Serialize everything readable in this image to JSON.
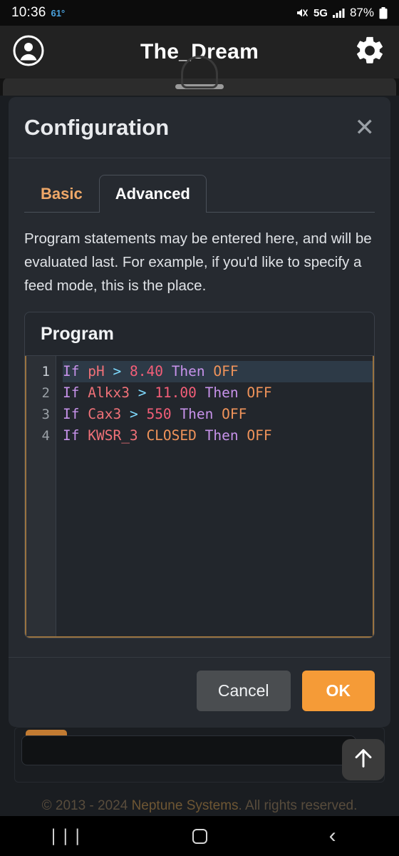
{
  "statusbar": {
    "time": "10:36",
    "temperature": "61°",
    "network": "5G",
    "battery_percent": "87%",
    "icons": {
      "mute": "mute-icon",
      "signal": "signal-bars-icon",
      "battery": "battery-icon"
    }
  },
  "header": {
    "title": "The_Dream",
    "account_icon": "account-circle-icon",
    "settings_icon": "gear-icon"
  },
  "modal": {
    "title": "Configuration",
    "close_label": "✕",
    "tabs": [
      {
        "label": "Basic",
        "active": false
      },
      {
        "label": "Advanced",
        "active": true
      }
    ],
    "description": "Program statements may be entered here, and will be evaluated last. For example, if you'd like to specify a feed mode, this is the place.",
    "program": {
      "card_title": "Program",
      "line_numbers": [
        "1",
        "2",
        "3",
        "4"
      ],
      "lines": [
        {
          "n": "1",
          "active": true,
          "text": "If pH > 8.40 Then OFF",
          "tokens": [
            [
              "kw",
              "If"
            ],
            [
              "sp",
              " "
            ],
            [
              "var",
              "pH"
            ],
            [
              "sp",
              " "
            ],
            [
              "op",
              ">"
            ],
            [
              "sp",
              " "
            ],
            [
              "num",
              "8.40"
            ],
            [
              "sp",
              " "
            ],
            [
              "kw",
              "Then"
            ],
            [
              "sp",
              " "
            ],
            [
              "val",
              "OFF"
            ]
          ]
        },
        {
          "n": "2",
          "active": false,
          "text": "If Alkx3 > 11.00 Then OFF",
          "tokens": [
            [
              "kw",
              "If"
            ],
            [
              "sp",
              " "
            ],
            [
              "var",
              "Alkx3"
            ],
            [
              "sp",
              " "
            ],
            [
              "op",
              ">"
            ],
            [
              "sp",
              " "
            ],
            [
              "num",
              "11.00"
            ],
            [
              "sp",
              " "
            ],
            [
              "kw",
              "Then"
            ],
            [
              "sp",
              " "
            ],
            [
              "val",
              "OFF"
            ]
          ]
        },
        {
          "n": "3",
          "active": false,
          "text": "If Cax3 > 550 Then OFF",
          "tokens": [
            [
              "kw",
              "If"
            ],
            [
              "sp",
              " "
            ],
            [
              "var",
              "Cax3"
            ],
            [
              "sp",
              " "
            ],
            [
              "op",
              ">"
            ],
            [
              "sp",
              " "
            ],
            [
              "num",
              "550"
            ],
            [
              "sp",
              " "
            ],
            [
              "kw",
              "Then"
            ],
            [
              "sp",
              " "
            ],
            [
              "val",
              "OFF"
            ]
          ]
        },
        {
          "n": "4",
          "active": false,
          "text": "If KWSR_3 CLOSED Then OFF",
          "tokens": [
            [
              "kw",
              "If"
            ],
            [
              "sp",
              " "
            ],
            [
              "var",
              "KWSR_3"
            ],
            [
              "sp",
              " "
            ],
            [
              "val",
              "CLOSED"
            ],
            [
              "sp",
              " "
            ],
            [
              "kw",
              "Then"
            ],
            [
              "sp",
              " "
            ],
            [
              "val",
              "OFF"
            ]
          ]
        }
      ]
    },
    "buttons": {
      "cancel": "Cancel",
      "ok": "OK"
    }
  },
  "background": {
    "footer_copyright_prefix": "© 2013 - 2024 ",
    "footer_brand": "Neptune Systems",
    "footer_copyright_suffix": ". All rights reserved.",
    "scroll_top_icon": "arrow-up-icon"
  },
  "navbar": {
    "recents": "|||",
    "home": "○",
    "back": "‹"
  },
  "colors": {
    "accent_orange": "#f59b37",
    "tab_inactive_orange": "#f0a868",
    "editor_border": "#9a7340",
    "modal_bg": "#262a30",
    "header_bg": "#222222",
    "keyword_purple": "#c792ea",
    "variable_red": "#f07178",
    "operator_cyan": "#7fdbff",
    "number_pink": "#f45e78",
    "value_orange": "#f0935a",
    "temp_blue": "#4aa3df"
  }
}
